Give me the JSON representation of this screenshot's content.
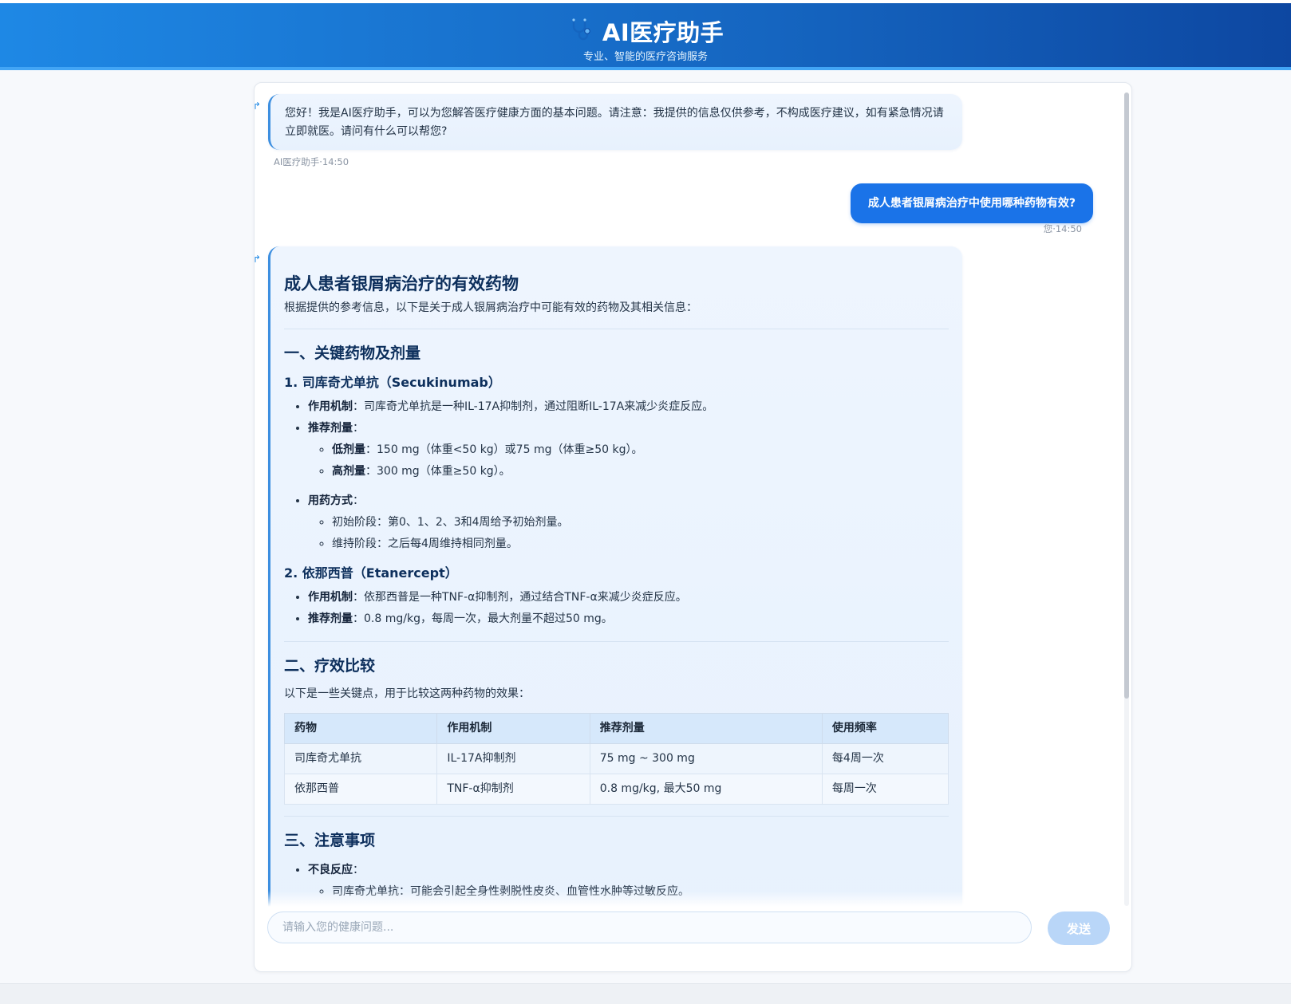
{
  "header": {
    "title": "AI医疗助手",
    "subtitle": "专业、智能的医疗咨询服务",
    "icon": "stethoscope-icon"
  },
  "messages": {
    "greeting": {
      "text": "您好！我是AI医疗助手，可以为您解答医疗健康方面的基本问题。请注意：我提供的信息仅供参考，不构成医疗建议，如有紧急情况请立即就医。请问有什么可以帮您?",
      "meta": "AI医疗助手·14:50"
    },
    "user": {
      "text": "成人患者银屑病治疗中使用哪种药物有效?",
      "meta": "您·14:50"
    },
    "answer": {
      "title": "成人患者银屑病治疗的有效药物",
      "intro": "根据提供的参考信息，以下是关于成人银屑病治疗中可能有效的药物及其相关信息：",
      "section1": {
        "heading": "一、关键药物及剂量",
        "drug1": {
          "heading": "1. 司库奇尤单抗（Secukinumab）",
          "mech_label": "作用机制",
          "mech_text": "：司库奇尤单抗是一种IL-17A抑制剂，通过阻断IL-17A来减少炎症反应。",
          "dose_label": "推荐剂量",
          "dose_colon": "：",
          "low_label": "低剂量",
          "low_text": "：150 mg（体重<50 kg）或75 mg（体重≥50 kg）。",
          "high_label": "高剂量",
          "high_text": "：300 mg（体重≥50 kg）。",
          "usage_label": "用药方式",
          "usage_colon": "：",
          "usage_items": [
            "初始阶段：第0、1、2、3和4周给予初始剂量。",
            "维持阶段：之后每4周维持相同剂量。"
          ]
        },
        "drug2": {
          "heading": "2. 依那西普（Etanercept）",
          "mech_label": "作用机制",
          "mech_text": "：依那西普是一种TNF-α抑制剂，通过结合TNF-α来减少炎症反应。",
          "dose_label": "推荐剂量",
          "dose_text": "：0.8 mg/kg，每周一次，最大剂量不超过50 mg。"
        }
      },
      "section2": {
        "heading": "二、疗效比较",
        "intro": "以下是一些关键点，用于比较这两种药物的效果：",
        "table": {
          "headers": [
            "药物",
            "作用机制",
            "推荐剂量",
            "使用频率"
          ],
          "rows": [
            [
              "司库奇尤单抗",
              "IL-17A抑制剂",
              "75 mg ~ 300 mg",
              "每4周一次"
            ],
            [
              "依那西普",
              "TNF-α抑制剂",
              "0.8 mg/kg, 最大50 mg",
              "每周一次"
            ]
          ]
        }
      },
      "section3": {
        "heading": "三、注意事项",
        "adverse_label": "不良反应",
        "adverse_colon": "：",
        "adverse_item1": "司库奇尤单抗：可能会引起全身性剥脱性皮炎、血管性水肿等过敏反应。"
      }
    }
  },
  "input": {
    "placeholder": "请输入您的健康问题...",
    "send_label": "发送"
  },
  "colors": {
    "header_start": "#1e88e5",
    "header_end": "#0d47a1",
    "user_bubble": "#1a73e8",
    "send_disabled": "#b9d6f8"
  }
}
